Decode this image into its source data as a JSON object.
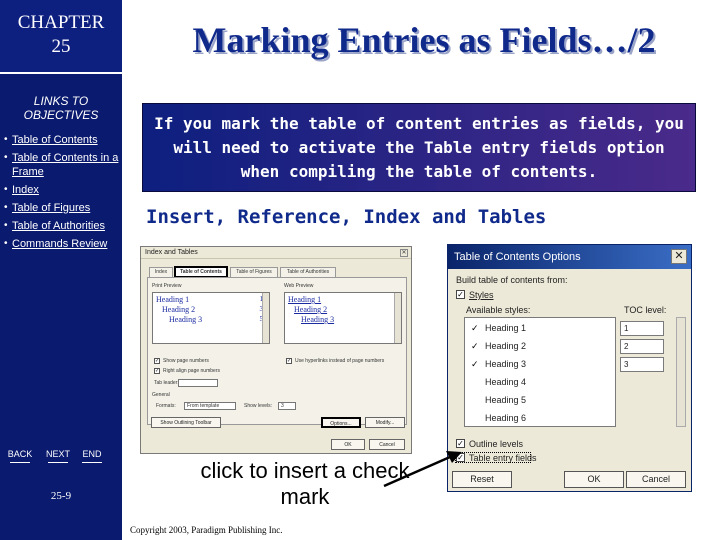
{
  "sidebar": {
    "chapter_label": "CHAPTER",
    "chapter_number": "25",
    "links_header": "LINKS TO OBJECTIVES",
    "links": [
      "Table of Contents",
      "Table of Contents in a Frame",
      "Index",
      "Table of Figures",
      "Table of Authorities",
      "Commands Review"
    ],
    "nav": {
      "back": "BACK",
      "next": "NEXT",
      "end": "END"
    },
    "page_number": "25-9"
  },
  "title": "Marking Entries as Fields…/2",
  "info_box_text": "If you mark the table of content entries as fields, you will need to activate the Table entry fields option when compiling the table of contents.",
  "menu_path": "Insert, Reference, Index and Tables",
  "index_dialog": {
    "title": "Index and Tables",
    "tabs": [
      "Index",
      "Table of Contents",
      "Table of Figures",
      "Table of Authorities"
    ],
    "print_preview_label": "Print Preview",
    "web_preview_label": "Web Preview",
    "print_preview_lines": [
      {
        "text": "Heading 1",
        "num": "1"
      },
      {
        "text": "Heading 2",
        "num": "3"
      },
      {
        "text": "Heading 3",
        "num": "5"
      }
    ],
    "web_preview_lines": [
      "Heading 1",
      "Heading 2",
      "Heading 3"
    ],
    "show_page_numbers": "Show page numbers",
    "right_align": "Right align page numbers",
    "tab_leader_label": "Tab leader:",
    "use_hyperlinks": "Use hyperlinks instead of page numbers",
    "general_label": "General",
    "formats_label": "Formats:",
    "formats_value": "From template",
    "show_levels_label": "Show levels:",
    "show_levels_value": "3",
    "show_outlining": "Show Outlining Toolbar",
    "options_button": "Options...",
    "modify_button": "Modify...",
    "ok_button": "OK",
    "cancel_button": "Cancel"
  },
  "toc_dialog": {
    "title": "Table of Contents Options",
    "build_label": "Build table of contents from:",
    "styles_label": "Styles",
    "available_styles_label": "Available styles:",
    "toc_level_label": "TOC level:",
    "styles": [
      {
        "name": "Heading 1",
        "checked": true,
        "level": "1"
      },
      {
        "name": "Heading 2",
        "checked": true,
        "level": "2"
      },
      {
        "name": "Heading 3",
        "checked": true,
        "level": "3"
      },
      {
        "name": "Heading 4",
        "checked": false,
        "level": ""
      },
      {
        "name": "Heading 5",
        "checked": false,
        "level": ""
      },
      {
        "name": "Heading 6",
        "checked": false,
        "level": ""
      }
    ],
    "outline_levels": "Outline levels",
    "table_entry_fields": "Table entry fields",
    "reset_button": "Reset",
    "ok_button": "OK",
    "cancel_button": "Cancel"
  },
  "annotation": "click to insert a check mark",
  "copyright": "Copyright 2003, Paradigm Publishing Inc."
}
